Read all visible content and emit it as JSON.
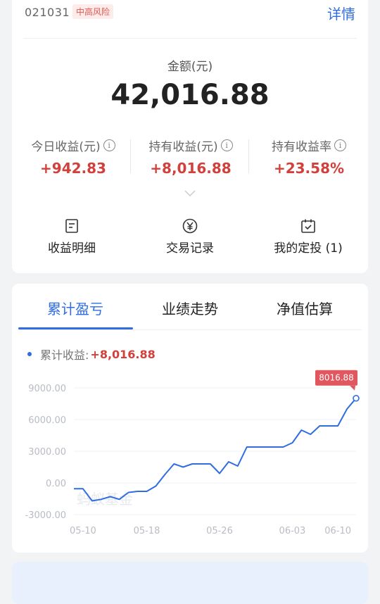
{
  "fund": {
    "code": "021031",
    "risk": "中高风险",
    "detail_link": "详情",
    "amount_label": "金额(元)",
    "amount_value": "42,016.88"
  },
  "stats": [
    {
      "label": "今日收益(元)",
      "value": "+942.83"
    },
    {
      "label": "持有收益(元)",
      "value": "+8,016.88"
    },
    {
      "label": "持有收益率",
      "value": "+23.58%"
    }
  ],
  "actions": [
    {
      "label": "收益明细",
      "icon": "document-icon"
    },
    {
      "label": "交易记录",
      "icon": "yuan-icon"
    },
    {
      "label": "我的定投 (1)",
      "icon": "calendar-check-icon"
    }
  ],
  "tabs": [
    {
      "label": "累计盈亏",
      "active": true
    },
    {
      "label": "业绩走势",
      "active": false
    },
    {
      "label": "净值估算",
      "active": false
    }
  ],
  "legend": {
    "label": "累计收益:",
    "value": "+8,016.88"
  },
  "watermark": "蚂蚁基金",
  "colors": {
    "accent": "#2f6de1",
    "gain": "#d2403b",
    "callout": "#e0575f"
  },
  "chart_data": {
    "type": "line",
    "callout_label": "8016.88",
    "y_ticks": [
      "9000.00",
      "6000.00",
      "3000.00",
      "0.00",
      "-3000.00"
    ],
    "ylim": [
      -3000,
      9000
    ],
    "x_ticks": [
      "05-10",
      "05-18",
      "05-26",
      "06-03",
      "06-10"
    ],
    "x_tick_index": [
      1,
      8,
      16,
      24,
      29
    ],
    "series": [
      {
        "values": [
          -550,
          -550,
          -1700,
          -1550,
          -1300,
          -1550,
          -900,
          -800,
          -800,
          -300,
          800,
          1800,
          1500,
          1800,
          1800,
          1800,
          900,
          2000,
          1600,
          3400,
          3400,
          3400,
          3400,
          3400,
          3800,
          5000,
          4600,
          5400,
          5400,
          5400,
          7000,
          8016.88
        ]
      }
    ]
  }
}
